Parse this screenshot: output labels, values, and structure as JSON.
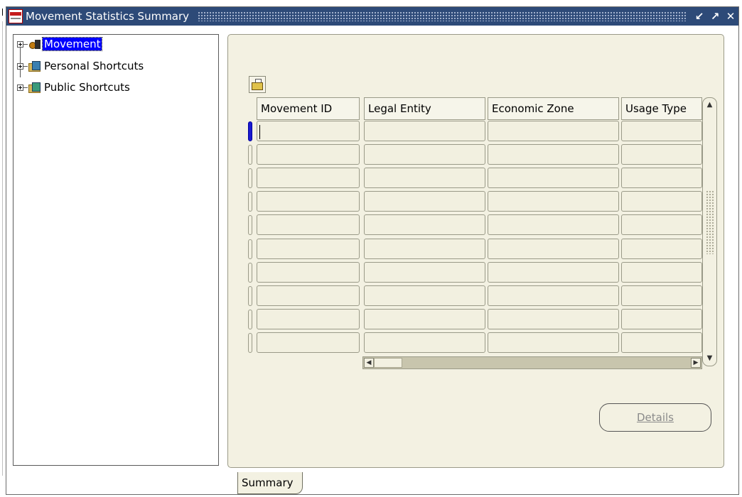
{
  "window": {
    "title": "Movement Statistics Summary",
    "buttons": [
      "↙",
      "↗",
      "✕"
    ]
  },
  "tree": {
    "items": [
      {
        "label": "Movement",
        "selected": true,
        "icon": "movement-icon"
      },
      {
        "label": "Personal Shortcuts",
        "selected": false,
        "icon": "personal-shortcuts-folder-icon"
      },
      {
        "label": "Public Shortcuts",
        "selected": false,
        "icon": "public-shortcuts-folder-icon"
      }
    ]
  },
  "grid": {
    "columns": [
      "Movement ID",
      "Legal Entity",
      "Economic Zone",
      "Usage Type"
    ],
    "row_count": 10,
    "active_row": 0
  },
  "scroll": {
    "left_arrow": "◀",
    "right_arrow": "▶",
    "up_arrow": "▲",
    "down_arrow": "▼"
  },
  "buttons": {
    "details": "Details"
  },
  "tabs": [
    {
      "label": "Summary",
      "active": true
    }
  ],
  "colors": {
    "titlebar": "#2d4a78",
    "panel_bg": "#f3f1e2",
    "selection": "#0000ff"
  }
}
